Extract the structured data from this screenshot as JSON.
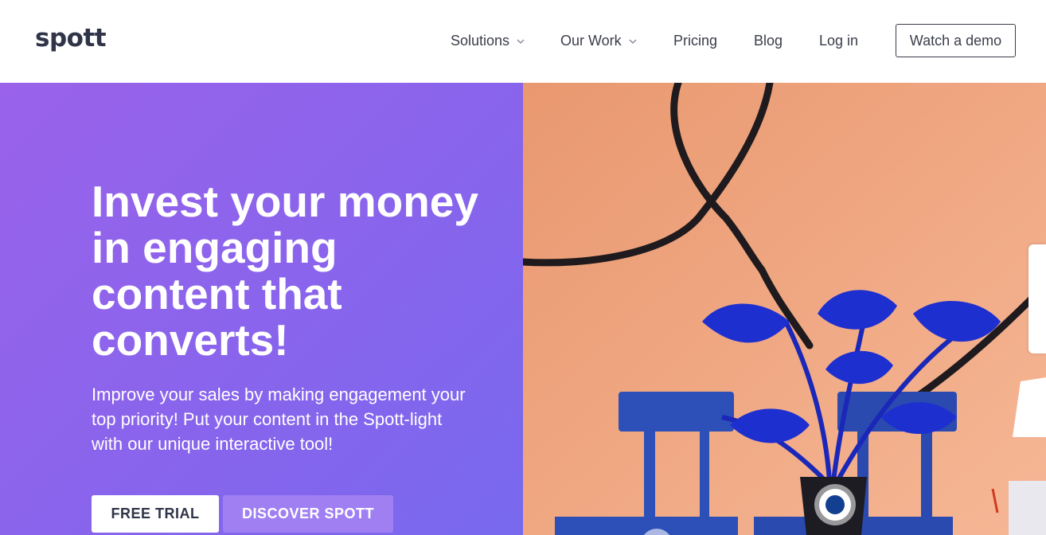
{
  "header": {
    "logo": "spott",
    "nav": {
      "solutions": "Solutions",
      "our_work": "Our Work",
      "pricing": "Pricing",
      "blog": "Blog",
      "login": "Log in"
    },
    "demo_button": "Watch a demo"
  },
  "hero": {
    "title": "Invest your money in engaging content that converts!",
    "subtitle": "Improve your sales by making engagement your top priority! Put your content in the Spott-light with our unique interactive tool!",
    "free_trial": "FREE TRIAL",
    "discover": "DISCOVER SPOTT"
  },
  "icons": {
    "nav_dropdown": "chevron-down-icon",
    "hotspot": "hotspot-marker-icon"
  },
  "colors": {
    "brand_text": "#2f3448",
    "hero_gradient_start": "#9a62ea",
    "hero_gradient_end": "#7869ee",
    "discover_button": "#a07ff2",
    "wall": "#efa47c",
    "plant_blue": "#1e2fd0"
  }
}
